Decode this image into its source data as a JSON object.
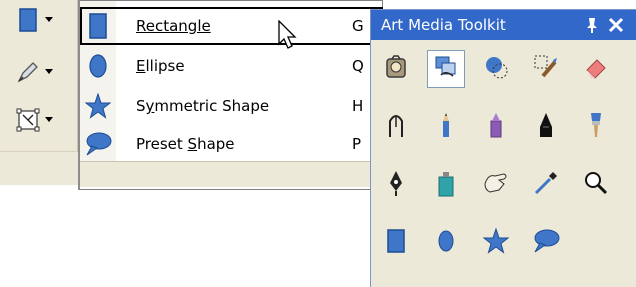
{
  "flyout": {
    "items": [
      {
        "label": "Rectangle",
        "mnemonic_index": 0,
        "shortcut": "G",
        "icon": "rectangle-icon"
      },
      {
        "label": "Ellipse",
        "mnemonic_index": 0,
        "shortcut": "Q",
        "icon": "ellipse-icon"
      },
      {
        "label": "Symmetric Shape",
        "mnemonic_index": 1,
        "shortcut": "H",
        "icon": "star-icon"
      },
      {
        "label": "Preset Shape",
        "mnemonic_index": 7,
        "shortcut": "P",
        "icon": "speech-bubble-icon"
      }
    ]
  },
  "panel": {
    "title": "Art Media Toolkit",
    "pin_glyph": "⩘",
    "close_glyph": "✖"
  },
  "colors": {
    "shape_blue": "#3f76c8",
    "title_blue": "#3168c9",
    "chrome": "#ece9d8"
  }
}
